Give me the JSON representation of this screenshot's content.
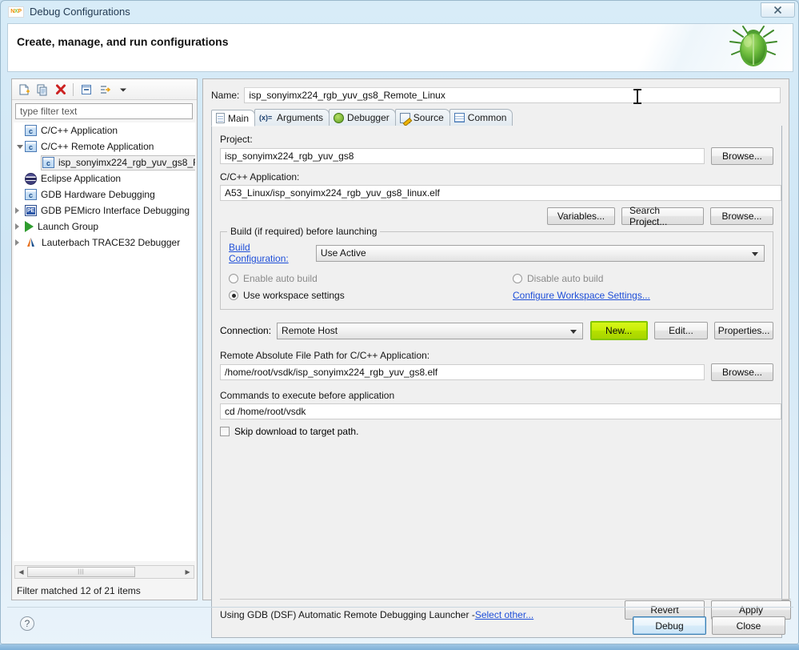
{
  "window": {
    "title": "Debug Configurations",
    "logo_icon": "nxp-logo-icon",
    "close_label": "✕"
  },
  "header": {
    "title": "Create, manage, and run configurations",
    "bug_icon": "green-bug-icon"
  },
  "tree_toolbar": {
    "buttons": [
      {
        "name": "new-configuration-button",
        "icon": "new-document-icon"
      },
      {
        "name": "duplicate-configuration-button",
        "icon": "copy-icon"
      },
      {
        "name": "delete-configuration-button",
        "icon": "red-x-delete-icon"
      },
      {
        "name": "collapse-all-button",
        "icon": "collapse-all-icon"
      },
      {
        "name": "filter-configurations-button",
        "icon": "filter-arrow-icon"
      },
      {
        "name": "view-menu-button",
        "icon": "chevron-down-icon"
      }
    ]
  },
  "filter": {
    "placeholder": "type filter text",
    "value": "",
    "status": "Filter matched 12 of 21 items"
  },
  "tree": {
    "items": [
      {
        "label": "C/C++ Application",
        "icon": "c-app-icon",
        "indent": 1,
        "twisty": "none",
        "selected": false
      },
      {
        "label": "C/C++ Remote Application",
        "icon": "c-app-icon",
        "indent": 1,
        "twisty": "open",
        "selected": false
      },
      {
        "label": "isp_sonyimx224_rgb_yuv_gs8_R",
        "icon": "c-app-icon",
        "indent": 2,
        "twisty": "none",
        "selected": true
      },
      {
        "label": "Eclipse Application",
        "icon": "eclipse-icon",
        "indent": 1,
        "twisty": "none",
        "selected": false
      },
      {
        "label": "GDB Hardware Debugging",
        "icon": "c-app-icon",
        "indent": 1,
        "twisty": "none",
        "selected": false
      },
      {
        "label": "GDB PEMicro Interface Debugging",
        "icon": "pemicro-icon",
        "indent": 1,
        "twisty": "closed",
        "selected": false
      },
      {
        "label": "Launch Group",
        "icon": "launch-group-icon",
        "indent": 1,
        "twisty": "closed",
        "selected": false
      },
      {
        "label": "Lauterbach TRACE32 Debugger",
        "icon": "lauterbach-icon",
        "indent": 1,
        "twisty": "closed",
        "selected": false
      }
    ]
  },
  "config": {
    "name_label": "Name:",
    "name_value": "isp_sonyimx224_rgb_yuv_gs8_Remote_Linux"
  },
  "tabs": [
    {
      "label": "Main",
      "icon": "main-document-icon",
      "active": true
    },
    {
      "label": "Arguments",
      "icon": "arguments-icon",
      "active": false
    },
    {
      "label": "Debugger",
      "icon": "debugger-bug-icon",
      "active": false
    },
    {
      "label": "Source",
      "icon": "source-pencil-icon",
      "active": false
    },
    {
      "label": "Common",
      "icon": "common-table-icon",
      "active": false
    }
  ],
  "main_tab": {
    "project_label": "Project:",
    "project_value": "isp_sonyimx224_rgb_yuv_gs8",
    "project_browse": "Browse...",
    "application_label": "C/C++ Application:",
    "application_value": "A53_Linux/isp_sonyimx224_rgb_yuv_gs8_linux.elf",
    "application_variables": "Variables...",
    "application_search": "Search Project...",
    "application_browse": "Browse...",
    "build_group_title": "Build (if required) before launching",
    "build_config_link": "Build Configuration:",
    "build_config_value": "Use Active",
    "enable_auto_build": "Enable auto build",
    "disable_auto_build": "Disable auto build",
    "use_workspace_settings": "Use workspace settings",
    "configure_workspace_link": "Configure Workspace Settings...",
    "selected_build_radio": "use_workspace_settings",
    "connection_label": "Connection:",
    "connection_value": "Remote Host",
    "connection_new": "New...",
    "connection_edit": "Edit...",
    "connection_properties": "Properties...",
    "remote_path_label": "Remote Absolute File Path for C/C++ Application:",
    "remote_path_value": "/home/root/vsdk/isp_sonyimx224_rgb_yuv_gs8.elf",
    "remote_path_browse": "Browse...",
    "commands_label": "Commands to execute before application",
    "commands_value": "cd /home/root/vsdk",
    "skip_download_label": "Skip download to target path.",
    "skip_download_checked": false
  },
  "tab_footer": {
    "launcher_text": "Using GDB (DSF) Automatic Remote Debugging Launcher - ",
    "select_other_link": "Select other...",
    "revert_label": "Revert",
    "apply_label": "Apply"
  },
  "dialog_footer": {
    "help_icon": "help-question-icon",
    "debug_label": "Debug",
    "close_label": "Close"
  },
  "colors": {
    "highlight_button": "#c8ee07",
    "highlight_border": "#85c700",
    "link": "#1f4fd8",
    "default_button_border": "#3c7fb1"
  }
}
